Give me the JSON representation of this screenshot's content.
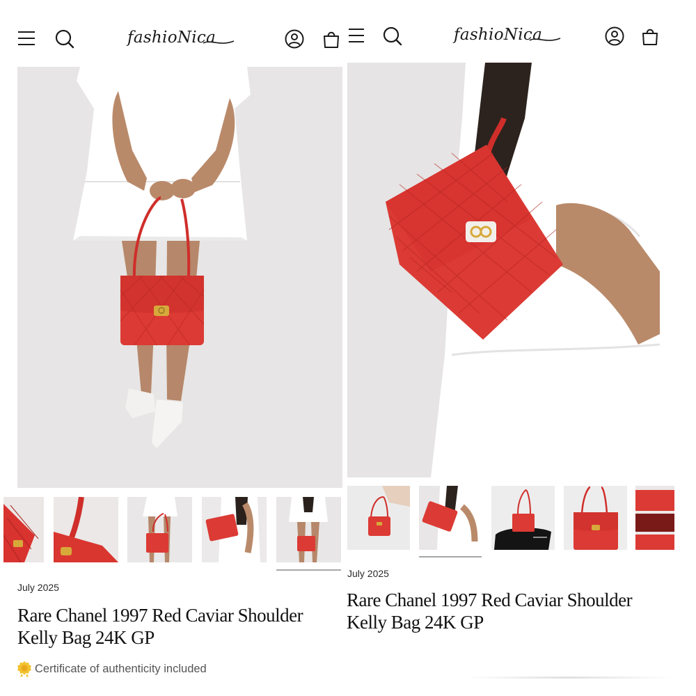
{
  "brand": {
    "logo_text": "fashioNica",
    "accent_red": "#d9322e",
    "bag_red": "#dc3a34",
    "gold": "#d7a93a"
  },
  "header": {
    "icons": [
      "menu-icon",
      "search-icon",
      "account-icon",
      "cart-icon"
    ]
  },
  "left_panel": {
    "date": "July 2025",
    "title_line1": "Rare Chanel 1997 Red Caviar Shoulder",
    "title_line2": "Kelly Bag 24K GP",
    "certificate_text": "Certificate of authenticity included",
    "thumbnails": [
      {
        "label": "bag-detail-closeup",
        "active": false
      },
      {
        "label": "bag-strap-closeup",
        "active": false
      },
      {
        "label": "model-holding-bag",
        "active": false
      },
      {
        "label": "model-shoulder-bag",
        "active": false
      },
      {
        "label": "model-holding-bag-front",
        "active": true
      }
    ]
  },
  "right_panel": {
    "date": "July 2025",
    "title_line1": "Rare Chanel 1997 Red Caviar Shoulder",
    "title_line2": "Kelly Bag 24K GP",
    "thumbnails": [
      {
        "label": "hand-holding-bag",
        "active": false
      },
      {
        "label": "model-shoulder-bag",
        "active": true
      },
      {
        "label": "bag-with-dustbag",
        "active": false
      },
      {
        "label": "bag-front-view",
        "active": false
      },
      {
        "label": "bag-interior-view",
        "active": false
      }
    ]
  }
}
